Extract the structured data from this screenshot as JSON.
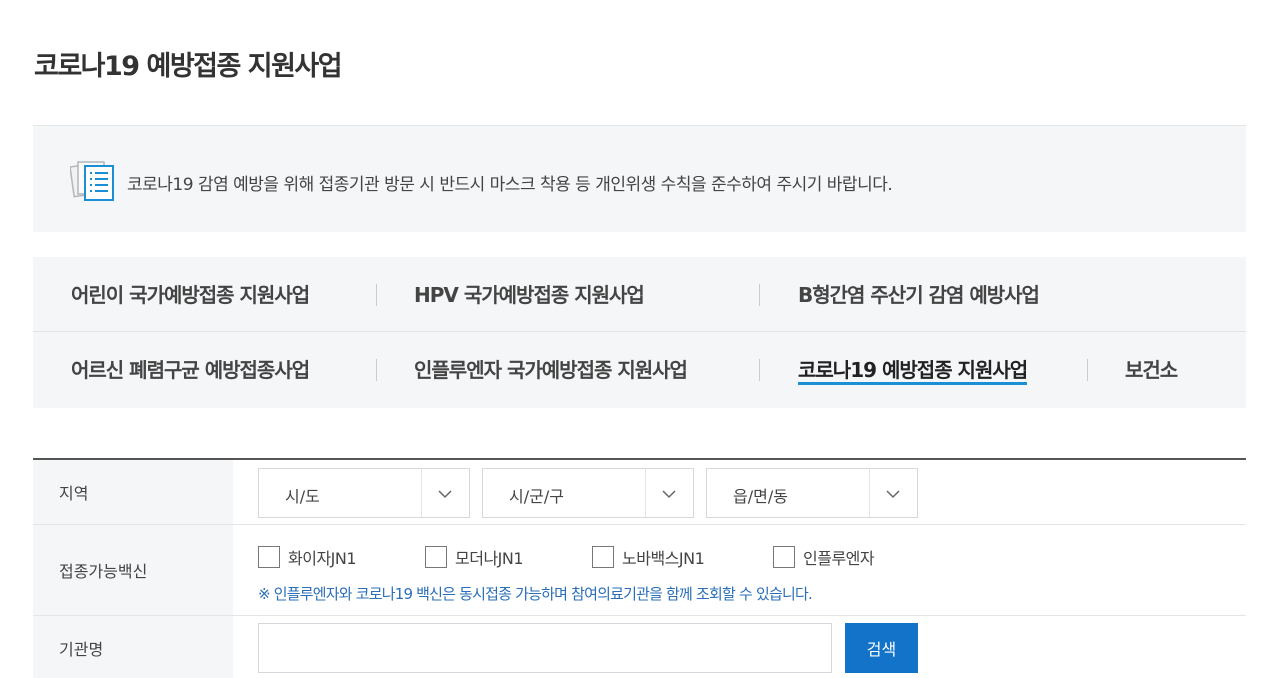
{
  "page_title": "코로나19 예방접종 지원사업",
  "notice": {
    "text": "코로나19 감염 예방을 위해 접종기관 방문 시 반드시 마스크 착용 등 개인위생 수칙을 준수하여 주시기 바랍니다."
  },
  "tabs": [
    "어린이 국가예방접종 지원사업",
    "HPV 국가예방접종 지원사업",
    "B형간염 주산기 감염 예방사업",
    "어르신 폐렴구균 예방접종사업",
    "인플루엔자 국가예방접종 지원사업",
    "코로나19 예방접종 지원사업",
    "보건소"
  ],
  "active_tab": "코로나19 예방접종 지원사업",
  "form": {
    "region_label": "지역",
    "region_selects": [
      "시/도",
      "시/군/구",
      "읍/면/동"
    ],
    "vaccine_label": "접종가능백신",
    "vaccines": [
      "화이자JN1",
      "모더나JN1",
      "노바백스JN1",
      "인플루엔자"
    ],
    "vaccine_note": "※ 인플루엔자와 코로나19 백신은 동시접종 가능하며 참여의료기관을 함께 조회할 수 있습니다.",
    "institution_label": "기관명",
    "institution_value": "",
    "search_button": "검색"
  },
  "colors": {
    "accent": "#1273c8",
    "active_underline": "#1a8fd6",
    "note_text": "#2a6fb8",
    "panel_bg": "#f4f6f8"
  }
}
